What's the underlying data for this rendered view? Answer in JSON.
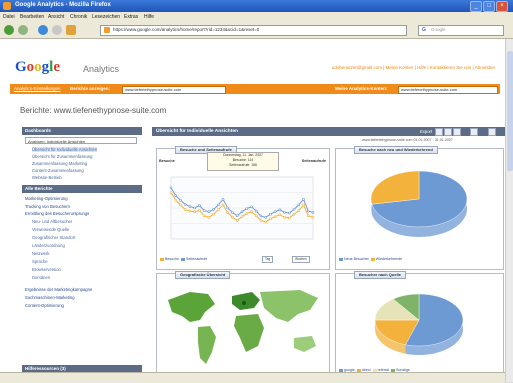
{
  "window": {
    "title": "Google Analytics - Mozilla Firefox"
  },
  "menu": [
    "Datei",
    "Bearbeiten",
    "Ansicht",
    "Chronik",
    "Lesezeichen",
    "Extras",
    "Hilfe"
  ],
  "browser": {
    "url": "https://www.google.com/analytics/home/report?rid=1234&scid=1&reset=0",
    "search_placeholder": "Google"
  },
  "header": {
    "logo_parts": [
      "G",
      "o",
      "o",
      "g",
      "l",
      "e"
    ],
    "product": "Analytics",
    "top_links": "udobenutzer@gmail.com  |  Meine Konten  |  Hilfe  |  Kontaktieren Sie uns  |  Abmelden"
  },
  "orangebar": {
    "crumb": "Analytics-Einstellungen",
    "profile_label": "Berichte anzeigen:",
    "profile_value": "www.tiefenethypnose-suite.com",
    "account_label": "Meine Analytics-Konten:",
    "account_value": "www.tiefenethypnose-suite.com"
  },
  "page_title": "Berichte: www.tiefenethypnose-suite.com",
  "sidebar": {
    "section1": "Dashboards",
    "dashboard_select": "Analysen: Individuelle Ansichten",
    "items1": [
      "Übersicht für Individuelle Ansichten",
      "Übersicht für Zusammenfassung",
      "Zusammenfassung Marketing",
      "Content-Zusammenfassung",
      "Website-Betrieb"
    ],
    "section2": "Alle Berichte",
    "items2": [
      "Marketing-Optimierung",
      "Tracking von Besuchern",
      "Ermittlung des Besucherursprungs"
    ],
    "items2_sub": [
      "Neu- und Altbesucher",
      "Verweisende Quelle",
      "Geografischer Standort",
      "Länderzuordnung",
      "Netzwerk",
      "Sprache",
      "Browserversion",
      "Domänen"
    ],
    "items3": [
      "Ergebnisse der Marketingkampagne",
      "Suchmaschinen-Marketing",
      "Content-Optimierung"
    ],
    "section3": "Hilferessourcen (3)"
  },
  "main": {
    "title": "Übersicht für Individuelle Ansichten",
    "export_label": "Export",
    "date_range": "www.tiefenethypnose-suite.com  01.01.2007 - 31.01.2007",
    "panels": {
      "visits": {
        "title": "Besuche und Seitenaufrufe",
        "left_label": "Besuche",
        "right_label": "Seitenaufrufe",
        "tooltip_line1": "Donnerstag, 11. Jan. 2007",
        "tooltip_line2": "Besuche: 114",
        "tooltip_line3": "Seitenaufrufe: 186",
        "legend": [
          "Besuche",
          "Seitenaufrufe"
        ],
        "tab_day": "Tag",
        "tab_week": "Wochen"
      },
      "newreturn": {
        "title": "Besuche nach neu und Wiederkehrend",
        "legend": [
          "Neue Besucher",
          "Wiederkehrende"
        ]
      },
      "geo": {
        "title": "Geografische Übersicht"
      },
      "sources": {
        "title": "Besucher nach Quelle",
        "legend": [
          "google",
          "direct",
          "referral",
          "Sonstige"
        ]
      }
    }
  },
  "chart_data": [
    {
      "type": "line",
      "title": "Besuche und Seitenaufrufe",
      "x": [
        "1",
        "2",
        "3",
        "4",
        "5",
        "6",
        "7",
        "8",
        "9",
        "10",
        "11",
        "12",
        "13",
        "14",
        "15",
        "16",
        "17",
        "18",
        "19",
        "20",
        "21",
        "22",
        "23",
        "24",
        "25",
        "26",
        "27",
        "28",
        "29",
        "30",
        "31"
      ],
      "series": [
        {
          "name": "Besuche",
          "values": [
            150,
            125,
            110,
            95,
            90,
            88,
            92,
            75,
            70,
            80,
            95,
            110,
            85,
            70,
            60,
            72,
            82,
            88,
            75,
            60,
            55,
            65,
            72,
            78,
            70,
            68,
            80,
            92,
            110,
            75,
            70
          ]
        },
        {
          "name": "Seitenaufrufe",
          "values": [
            165,
            140,
            125,
            112,
            105,
            100,
            108,
            92,
            88,
            95,
            110,
            128,
            100,
            85,
            75,
            88,
            98,
            104,
            90,
            74,
            70,
            80,
            88,
            94,
            86,
            84,
            96,
            110,
            128,
            90,
            86
          ]
        }
      ],
      "ylim": [
        0,
        200
      ]
    },
    {
      "type": "pie",
      "title": "Besuche nach neu und Wiederkehrend",
      "categories": [
        "Neue Besucher",
        "Wiederkehrende"
      ],
      "values": [
        72,
        28
      ]
    },
    {
      "type": "pie",
      "title": "Besucher nach Quelle",
      "categories": [
        "google",
        "direct",
        "referral",
        "Sonstige"
      ],
      "values": [
        55,
        20,
        15,
        10
      ]
    }
  ],
  "colors": {
    "orange": "#f08a18",
    "navy": "#5c6c87",
    "blue": "#6e9ad3",
    "gold": "#f2b23c",
    "link": "#2a4a88"
  }
}
